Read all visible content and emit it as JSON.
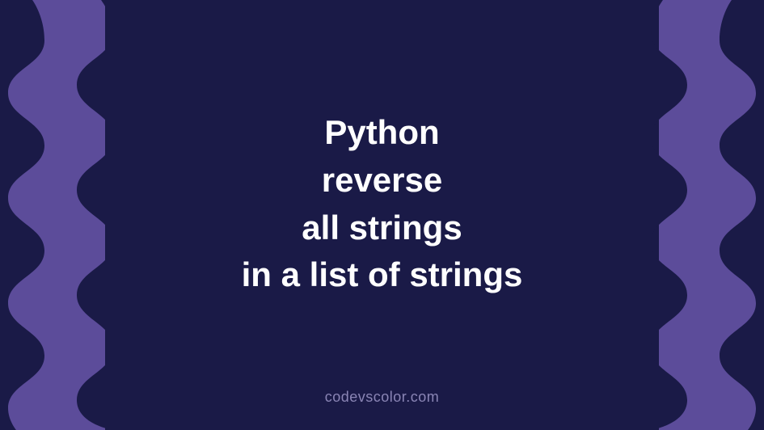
{
  "title": {
    "line1": "Python",
    "line2": "reverse",
    "line3": "all strings",
    "line4": "in a list of strings"
  },
  "watermark": "codevscolor.com",
  "colors": {
    "background": "#5c4c9a",
    "panel": "#1a1a47",
    "text": "#ffffff",
    "watermark": "#8a85b5"
  }
}
